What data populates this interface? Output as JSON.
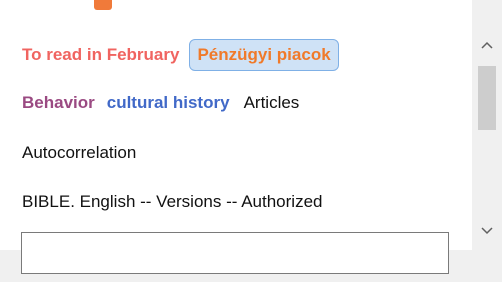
{
  "tags": {
    "row1": [
      {
        "label": "To read in February"
      },
      {
        "label": "Pénzügyi piacok"
      }
    ],
    "row2": [
      {
        "label": "Behavior"
      },
      {
        "label": "cultural history"
      },
      {
        "label": "Articles"
      }
    ],
    "row3": [
      {
        "label": "Autocorrelation"
      }
    ],
    "row4": [
      {
        "label": "BIBLE. English -- Versions -- Authorized"
      }
    ]
  },
  "colors": {
    "red_tag": "#f06460",
    "orange_tag": "#f07a2a",
    "purple_tag": "#9a4a82",
    "blue_tag": "#4169c8",
    "selected_bg": "#cfe2f6"
  },
  "icons": {
    "scroll_up": "chevron-up-icon",
    "scroll_down": "chevron-down-icon"
  },
  "input": {
    "value": "",
    "placeholder": ""
  }
}
